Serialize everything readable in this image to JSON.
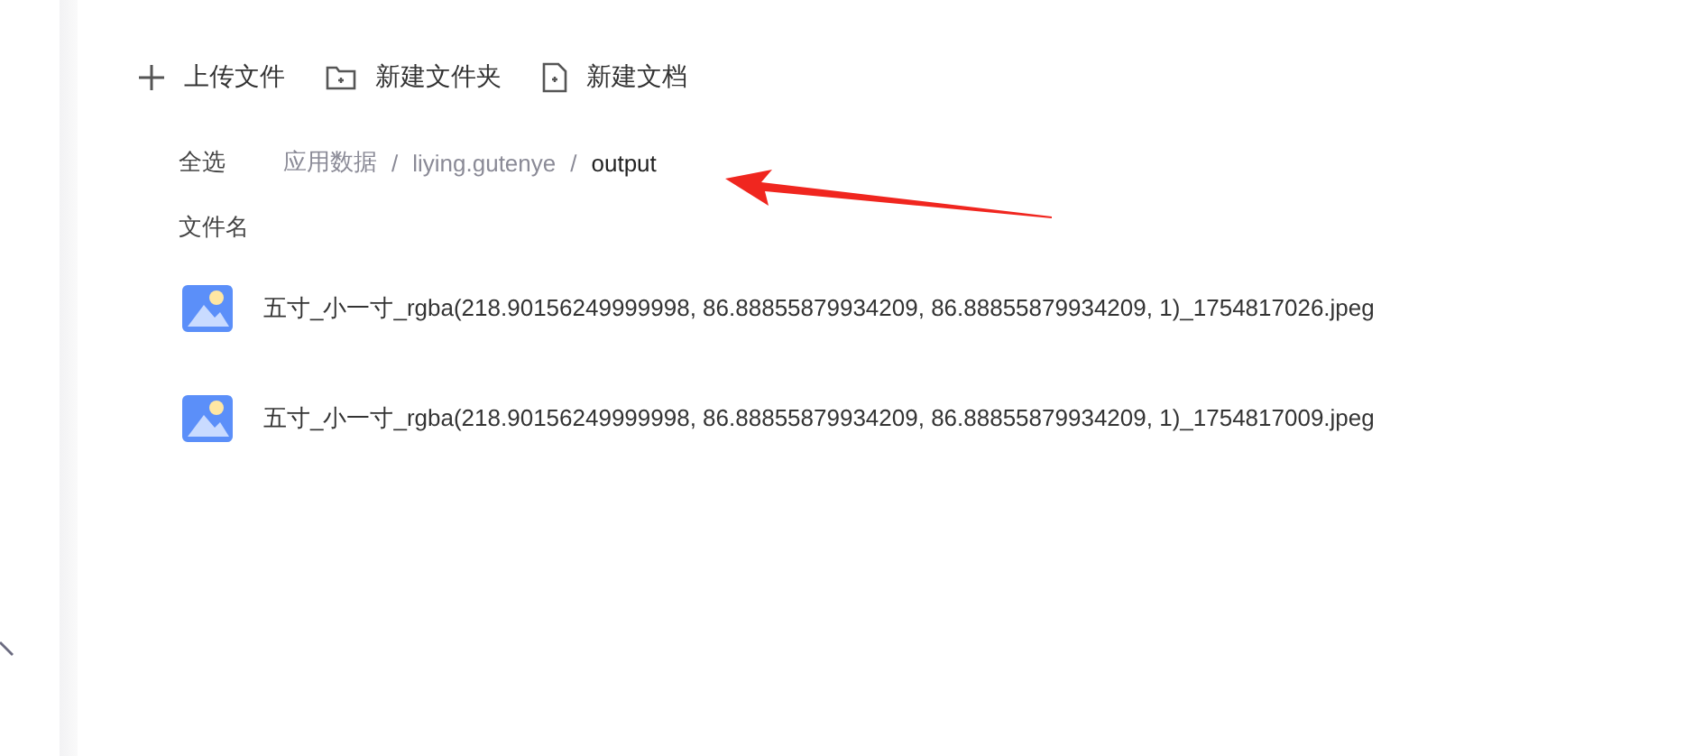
{
  "toolbar": [
    {
      "kind": "plus",
      "label": "上传文件"
    },
    {
      "kind": "folder",
      "label": "新建文件夹"
    },
    {
      "kind": "doc",
      "label": "新建文档"
    }
  ],
  "select_all": "全选",
  "breadcrumb": {
    "separator": "/",
    "items": [
      {
        "label": "应用数据",
        "current": false
      },
      {
        "label": "liying.gutenye",
        "current": false
      },
      {
        "label": "output",
        "current": true
      }
    ]
  },
  "column_header": "文件名",
  "files": [
    {
      "name": "五寸_小一寸_rgba(218.90156249999998, 86.88855879934209, 86.88855879934209, 1)_1754817026.jpeg"
    },
    {
      "name": "五寸_小一寸_rgba(218.90156249999998, 86.88855879934209, 86.88855879934209, 1)_1754817009.jpeg"
    }
  ]
}
